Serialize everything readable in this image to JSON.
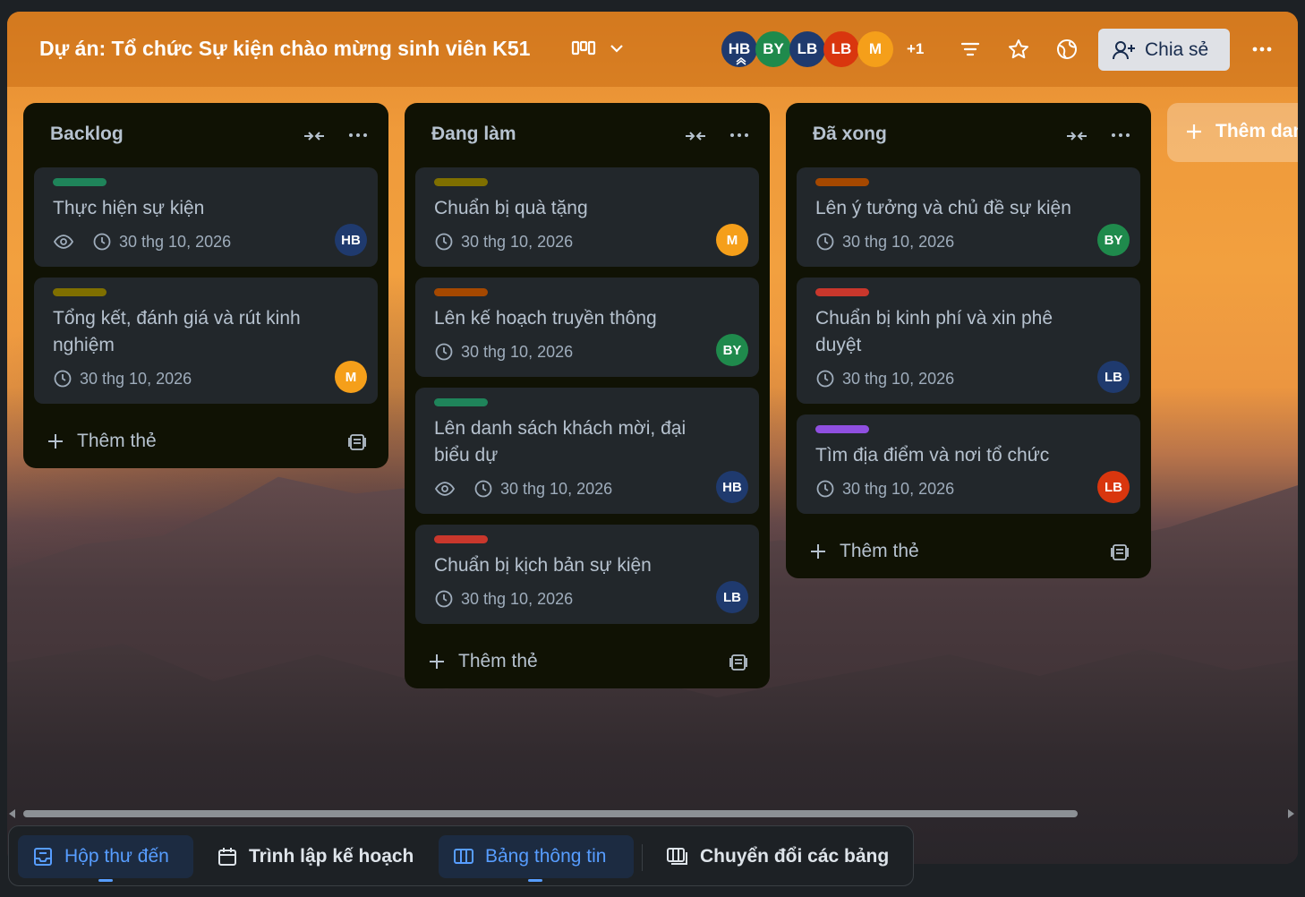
{
  "header": {
    "title": "Dự án: Tổ chức Sự kiện chào mừng sinh viên K51",
    "view_icon": "board-view-icon",
    "members": [
      {
        "initials": "HB",
        "color": "#1f3a6e",
        "admin": true
      },
      {
        "initials": "BY",
        "color": "#1f8a4c"
      },
      {
        "initials": "LB",
        "color": "#1f3a6e"
      },
      {
        "initials": "LB",
        "color": "#d9360e"
      },
      {
        "initials": "M",
        "color": "#f59f1a"
      }
    ],
    "more_members": "+1",
    "share_label": "Chia sẻ"
  },
  "lists": [
    {
      "title": "Backlog",
      "add_label": "Thêm thẻ",
      "cards": [
        {
          "label_color": "#1f845a",
          "title": "Thực hiện sự kiện",
          "watched": true,
          "due": "30 thg 10, 2026",
          "member": "HB",
          "member_color": "#1f3a6e"
        },
        {
          "label_color": "#7f6f00",
          "title": "Tổng kết, đánh giá và rút kinh nghiệm",
          "watched": false,
          "due": "30 thg 10, 2026",
          "member": "M",
          "member_color": "#f59f1a"
        }
      ]
    },
    {
      "title": "Đang làm",
      "add_label": "Thêm thẻ",
      "cards": [
        {
          "label_color": "#7f6f00",
          "title": "Chuẩn bị quà tặng",
          "watched": false,
          "due": "30 thg 10, 2026",
          "member": "M",
          "member_color": "#f59f1a"
        },
        {
          "label_color": "#a54800",
          "title": "Lên kế hoạch truyền thông",
          "watched": false,
          "due": "30 thg 10, 2026",
          "member": "BY",
          "member_color": "#1f8a4c"
        },
        {
          "label_color": "#1f845a",
          "title": "Lên danh sách khách mời, đại biểu dự",
          "watched": true,
          "due": "30 thg 10, 2026",
          "member": "HB",
          "member_color": "#1f3a6e"
        },
        {
          "label_color": "#c9372c",
          "title": "Chuẩn bị kịch bản sự kiện",
          "watched": false,
          "due": "30 thg 10, 2026",
          "member": "LB",
          "member_color": "#1f3a6e"
        }
      ]
    },
    {
      "title": "Đã xong",
      "add_label": "Thêm thẻ",
      "cards": [
        {
          "label_color": "#a54800",
          "title": "Lên ý tưởng và chủ đề sự kiện",
          "watched": false,
          "due": "30 thg 10, 2026",
          "member": "BY",
          "member_color": "#1f8a4c"
        },
        {
          "label_color": "#c9372c",
          "title": "Chuẩn bị kinh phí và xin phê duyệt",
          "watched": false,
          "due": "30 thg 10, 2026",
          "member": "LB",
          "member_color": "#1f3a6e"
        },
        {
          "label_color": "#8f4fe0",
          "title": "Tìm địa điểm và nơi tổ chức",
          "watched": false,
          "due": "30 thg 10, 2026",
          "member": "LB",
          "member_color": "#d9360e"
        }
      ]
    }
  ],
  "add_list_label": "Thêm danh sách khác",
  "bottom_nav": {
    "inbox": "Hộp thư đến",
    "planner": "Trình lập kế hoạch",
    "board": "Bảng thông tin",
    "switch": "Chuyển đổi các bảng"
  }
}
